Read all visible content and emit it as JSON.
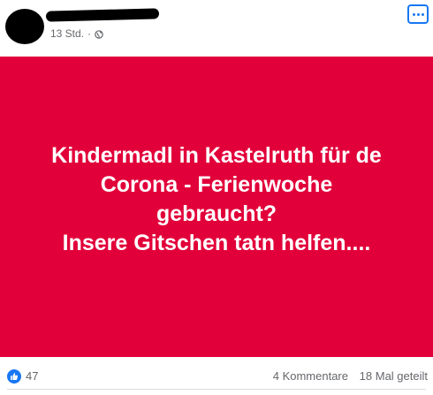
{
  "post": {
    "meta": {
      "time": "13 Std.",
      "separator": "·",
      "privacy_icon": "globe-icon"
    },
    "more_icon": "more-options-icon",
    "banner": {
      "background": "#e2003a",
      "lines": [
        "Kindermadl in Kastelruth für de",
        "Corona - Ferienwoche",
        "gebraucht?",
        "Insere Gitschen tatn helfen...."
      ]
    },
    "footer": {
      "reaction_icon": "like-icon",
      "reaction_count": "47",
      "comments": "4 Kommentare",
      "shares": "18 Mal geteilt"
    }
  },
  "colors": {
    "accent": "#1877f2",
    "muted_text": "#65676b"
  }
}
